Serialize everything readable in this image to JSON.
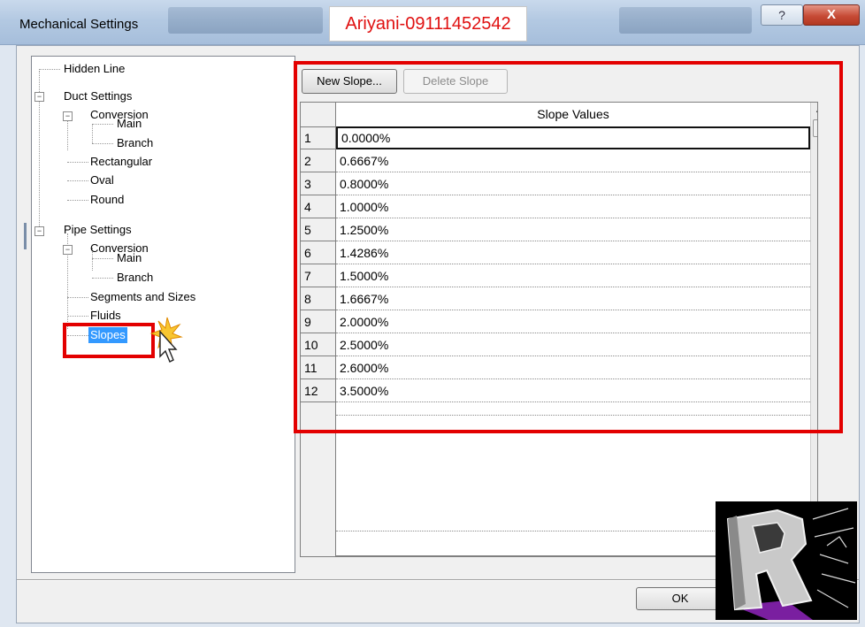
{
  "window": {
    "title": "Mechanical Settings",
    "watermark_text": "Ariyani-09111452542",
    "help_label": "?",
    "close_label": "X"
  },
  "tree": {
    "items": [
      {
        "label": "Hidden Line"
      },
      {
        "label": "Duct Settings"
      },
      {
        "label": "Conversion"
      },
      {
        "label": "Main"
      },
      {
        "label": "Branch"
      },
      {
        "label": "Rectangular"
      },
      {
        "label": "Oval"
      },
      {
        "label": "Round"
      },
      {
        "label": "Pipe Settings"
      },
      {
        "label": "Conversion"
      },
      {
        "label": "Main"
      },
      {
        "label": "Branch"
      },
      {
        "label": "Segments and Sizes"
      },
      {
        "label": "Fluids"
      },
      {
        "label": "Slopes",
        "selected": true
      }
    ],
    "expander_symbol": "−"
  },
  "toolbar": {
    "new_slope_label": "New Slope...",
    "delete_slope_label": "Delete Slope"
  },
  "grid": {
    "column_header": "Slope Values",
    "rows": [
      {
        "num": "1",
        "value": "0.0000%"
      },
      {
        "num": "2",
        "value": "0.6667%"
      },
      {
        "num": "3",
        "value": "0.8000%"
      },
      {
        "num": "4",
        "value": "1.0000%"
      },
      {
        "num": "5",
        "value": "1.2500%"
      },
      {
        "num": "6",
        "value": "1.4286%"
      },
      {
        "num": "7",
        "value": "1.5000%"
      },
      {
        "num": "8",
        "value": "1.6667%"
      },
      {
        "num": "9",
        "value": "2.0000%"
      },
      {
        "num": "10",
        "value": "2.5000%"
      },
      {
        "num": "11",
        "value": "2.6000%"
      },
      {
        "num": "12",
        "value": "3.5000%"
      }
    ],
    "scroll_up_arrow": "▲"
  },
  "footer": {
    "ok_label": "OK"
  },
  "colors": {
    "highlight_red": "#e30000",
    "selection_blue": "#3399ff"
  }
}
